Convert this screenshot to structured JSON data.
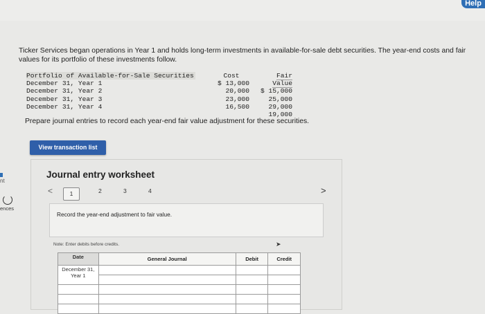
{
  "help_label": "Help",
  "left_rail": {
    "text1": "nt",
    "text2": "ences"
  },
  "problem_text": "Ticker Services began operations in Year 1 and holds long-term investments in available-for-sale debt securities. The year-end costs and fair values for its portfolio of these investments follow.",
  "portfolio": {
    "header_label": "Portfolio of Available-for-Sale Securities",
    "header_cost": "Cost",
    "header_fair": "Fair Value",
    "rows": [
      {
        "label": "December 31, Year 1",
        "cost": "$ 13,000",
        "fair": "$ 15,000"
      },
      {
        "label": "December 31, Year 2",
        "cost": "20,000",
        "fair": "25,000"
      },
      {
        "label": "December 31, Year 3",
        "cost": "23,000",
        "fair": "29,000"
      },
      {
        "label": "December 31, Year 4",
        "cost": "16,500",
        "fair": "19,000"
      }
    ]
  },
  "prompt": "Prepare journal entries to record each year-end fair value adjustment for these securities.",
  "view_button": "View transaction list",
  "worksheet": {
    "title": "Journal entry worksheet",
    "pages": [
      "1",
      "2",
      "3",
      "4"
    ],
    "prev_label": "<",
    "next_label": ">",
    "instruction": "Record the year-end adjustment to fair value.",
    "note": "Note: Enter debits before credits.",
    "columns": {
      "date": "Date",
      "account": "General Journal",
      "debit": "Debit",
      "credit": "Credit"
    },
    "date_value": "December 31, Year 1"
  }
}
